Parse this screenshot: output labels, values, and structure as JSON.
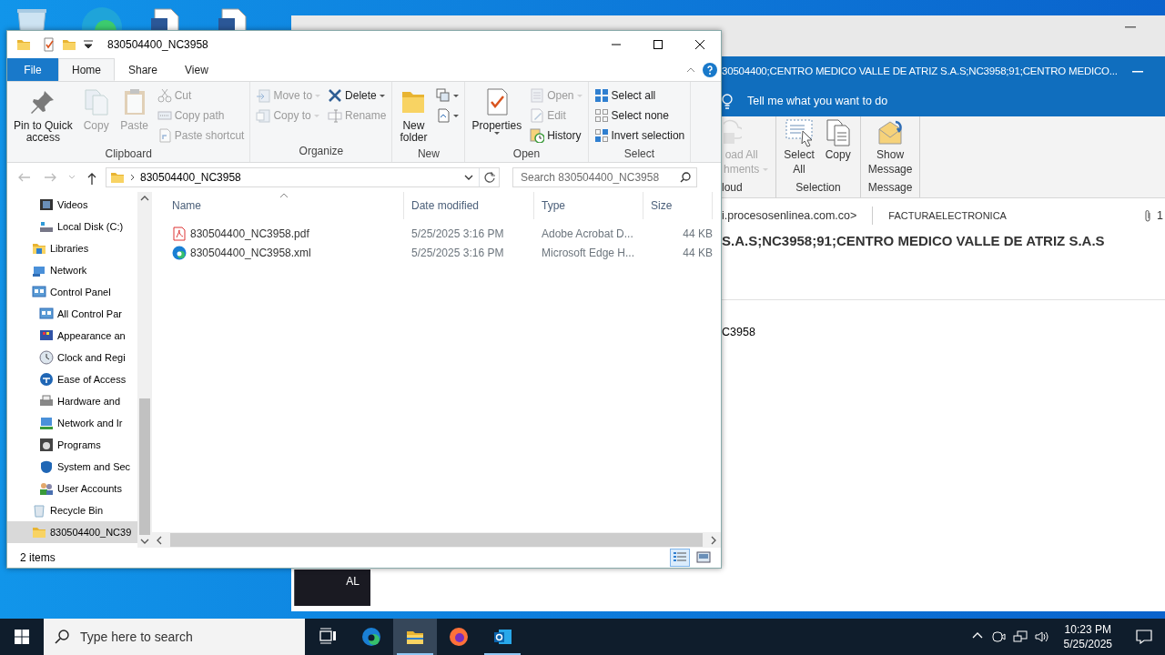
{
  "desktop_icons": [
    {
      "kind": "recycle"
    },
    {
      "kind": "edge"
    },
    {
      "kind": "word"
    },
    {
      "kind": "word"
    }
  ],
  "outlook": {
    "title": "30504400;CENTRO MEDICO VALLE DE ATRIZ S.A.S;NC3958;91;CENTRO MEDICO...",
    "tell_me": "Tell me what you want to do",
    "ribbon_groups": [
      {
        "label": "loud",
        "buttons": [
          {
            "label": "oad All\nhments",
            "disabled": true,
            "dropdown": true
          }
        ]
      },
      {
        "label": "Selection",
        "buttons": [
          {
            "label": "Select\nAll",
            "disabled": false,
            "dropdown": false
          },
          {
            "label": "Copy",
            "disabled": false,
            "dropdown": false
          }
        ]
      },
      {
        "label": "Message",
        "buttons": [
          {
            "label": "Show\nMessage",
            "disabled": false,
            "dropdown": false
          }
        ]
      }
    ],
    "sender": "i.procesosenlinea.com.co>",
    "recipient": "FACTURAELECTRONICA",
    "attachments": "1",
    "subject": "S.A.S;NC3958;91;CENTRO MEDICO VALLE DE ATRIZ S.A.S",
    "body": "C3958",
    "preview": "AL"
  },
  "explorer": {
    "title": "830504400_NC3958",
    "tabs": [
      {
        "label": "File",
        "kind": "menu",
        "selected": false
      },
      {
        "label": "Home",
        "kind": "tab",
        "selected": true
      },
      {
        "label": "Share",
        "kind": "tab",
        "selected": false
      },
      {
        "label": "View",
        "kind": "tab",
        "selected": false
      }
    ],
    "ribbon_groups": [
      {
        "label": "Clipboard",
        "items": [
          {
            "kind": "large",
            "label": "Pin to Quick\naccess",
            "disabled": false,
            "dropdown": false
          },
          {
            "kind": "large",
            "label": "Copy",
            "disabled": true,
            "dropdown": false
          },
          {
            "kind": "large",
            "label": "Paste",
            "disabled": true,
            "dropdown": false
          },
          {
            "kind": "stack",
            "items": [
              {
                "label": "Cut",
                "disabled": true,
                "dropdown": false
              },
              {
                "label": "Copy path",
                "disabled": true,
                "dropdown": false
              },
              {
                "label": "Paste shortcut",
                "disabled": true,
                "dropdown": false
              }
            ]
          }
        ]
      },
      {
        "label": "Organize",
        "items": [
          {
            "kind": "stack",
            "items": [
              {
                "label": "Move to",
                "disabled": true,
                "dropdown": true
              },
              {
                "label": "Copy to",
                "disabled": true,
                "dropdown": true
              }
            ]
          },
          {
            "kind": "stack",
            "items": [
              {
                "label": "Delete",
                "disabled": false,
                "dropdown": true
              },
              {
                "label": "Rename",
                "disabled": true,
                "dropdown": false
              }
            ]
          }
        ]
      },
      {
        "label": "New",
        "items": [
          {
            "kind": "large",
            "label": "New\nfolder",
            "disabled": false,
            "dropdown": false
          },
          {
            "kind": "stack",
            "items": [
              {
                "disabled": false,
                "dropdown": true
              },
              {
                "disabled": false,
                "dropdown": true
              }
            ]
          }
        ]
      },
      {
        "label": "Open",
        "items": [
          {
            "kind": "large",
            "label": "Properties",
            "disabled": false,
            "dropdown": true
          },
          {
            "kind": "stack",
            "items": [
              {
                "label": "Open",
                "disabled": true,
                "dropdown": true
              },
              {
                "label": "Edit",
                "disabled": true,
                "dropdown": false
              },
              {
                "label": "History",
                "disabled": false,
                "dropdown": false
              }
            ]
          }
        ]
      },
      {
        "label": "Select",
        "items": [
          {
            "kind": "stack",
            "items": [
              {
                "label": "Select all",
                "disabled": false,
                "dropdown": false
              },
              {
                "label": "Select none",
                "disabled": false,
                "dropdown": false
              },
              {
                "label": "Invert selection",
                "disabled": false,
                "dropdown": false
              }
            ]
          }
        ]
      }
    ],
    "path": "830504400_NC3958",
    "search_placeholder": "Search 830504400_NC3958",
    "nav": [
      {
        "children": [
          {
            "label": "Videos",
            "selected": false
          },
          {
            "label": "Local Disk (C:)",
            "selected": false
          }
        ]
      },
      {
        "label": "Libraries",
        "selected": false
      },
      {
        "label": "Network",
        "selected": false
      },
      {
        "label": "Control Panel",
        "selected": false,
        "children": [
          {
            "label": "All Control Par",
            "selected": false
          },
          {
            "label": "Appearance an",
            "selected": false
          },
          {
            "label": "Clock and Regi",
            "selected": false
          },
          {
            "label": "Ease of Access",
            "selected": false
          },
          {
            "label": "Hardware and",
            "selected": false
          },
          {
            "label": "Network and Ir",
            "selected": false
          },
          {
            "label": "Programs",
            "selected": false
          },
          {
            "label": "System and Sec",
            "selected": false
          },
          {
            "label": "User Accounts",
            "selected": false
          }
        ]
      },
      {
        "label": "Recycle Bin",
        "selected": false
      },
      {
        "label": "830504400_NC39",
        "selected": true
      }
    ],
    "columns": [
      {
        "label": "Name",
        "sorted": true
      },
      {
        "label": "Date modified",
        "sorted": false
      },
      {
        "label": "Type",
        "sorted": false
      },
      {
        "label": "Size",
        "sorted": false
      }
    ],
    "files": [
      {
        "kind": "pdf",
        "name": "830504400_NC3958.pdf",
        "date": "5/25/2025 3:16 PM",
        "type": "Adobe Acrobat D...",
        "size": "44 KB"
      },
      {
        "kind": "edge",
        "name": "830504400_NC3958.xml",
        "date": "5/25/2025 3:16 PM",
        "type": "Microsoft Edge H...",
        "size": "44 KB"
      }
    ],
    "status": "2 items",
    "views": [
      {
        "selected": true
      },
      {
        "selected": false
      }
    ]
  },
  "taskbar": {
    "search_placeholder": "Type here to search",
    "apps": [
      {
        "active": false,
        "running": false
      },
      {
        "active": false,
        "running": false
      },
      {
        "active": true,
        "running": true
      },
      {
        "active": false,
        "running": false
      },
      {
        "active": false,
        "running": true
      }
    ],
    "time": "10:23 PM",
    "date": "5/25/2025"
  }
}
